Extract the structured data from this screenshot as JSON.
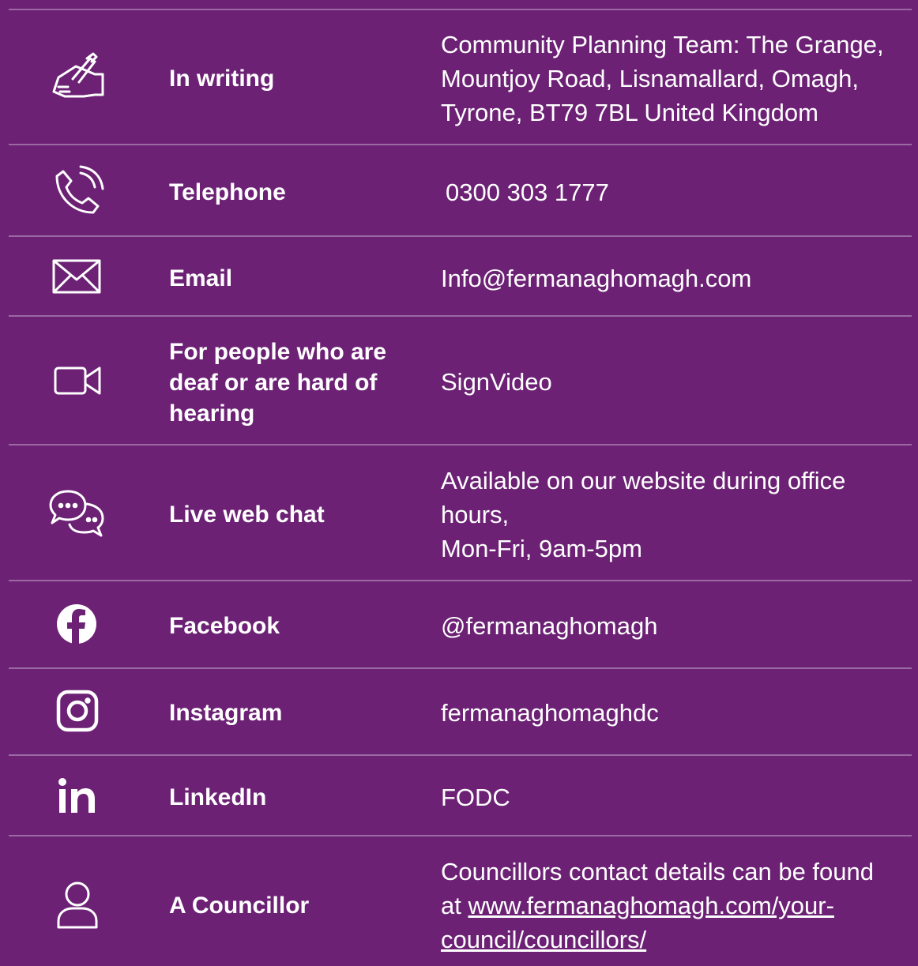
{
  "colors": {
    "background": "#6c2175",
    "divider": "#9b6aa3",
    "text": "#ffffff"
  },
  "rows": [
    {
      "icon": "writing-hand-icon",
      "label": "In writing",
      "value_lines": [
        "Community Planning Team: The Grange,",
        "Mountjoy Road, Lisnamallard, Omagh,",
        "Tyrone, BT79 7BL United Kingdom"
      ]
    },
    {
      "icon": "phone-icon",
      "label": "Telephone",
      "value": "0300 303 1777"
    },
    {
      "icon": "envelope-icon",
      "label": "Email",
      "value": "Info@fermanaghomagh.com"
    },
    {
      "icon": "video-camera-icon",
      "label_lines": [
        "For people who are",
        "deaf or are hard of",
        "hearing"
      ],
      "value": "SignVideo"
    },
    {
      "icon": "chat-bubbles-icon",
      "label": "Live web chat",
      "value_lines": [
        "Available on our website during office",
        "hours,",
        "Mon-Fri, 9am-5pm"
      ]
    },
    {
      "icon": "facebook-icon",
      "label": "Facebook",
      "value": "@fermanaghomagh"
    },
    {
      "icon": "instagram-icon",
      "label": "Instagram",
      "value": "fermanaghomaghdc"
    },
    {
      "icon": "linkedin-icon",
      "label": "LinkedIn",
      "value": "FODC"
    },
    {
      "icon": "person-icon",
      "label": "A Councillor",
      "value_text": "Councillors contact details can be found",
      "value_prefix": "at ",
      "value_link_1": "www.fermanaghomagh.com/your-",
      "value_link_2": "council/councillors/"
    }
  ]
}
